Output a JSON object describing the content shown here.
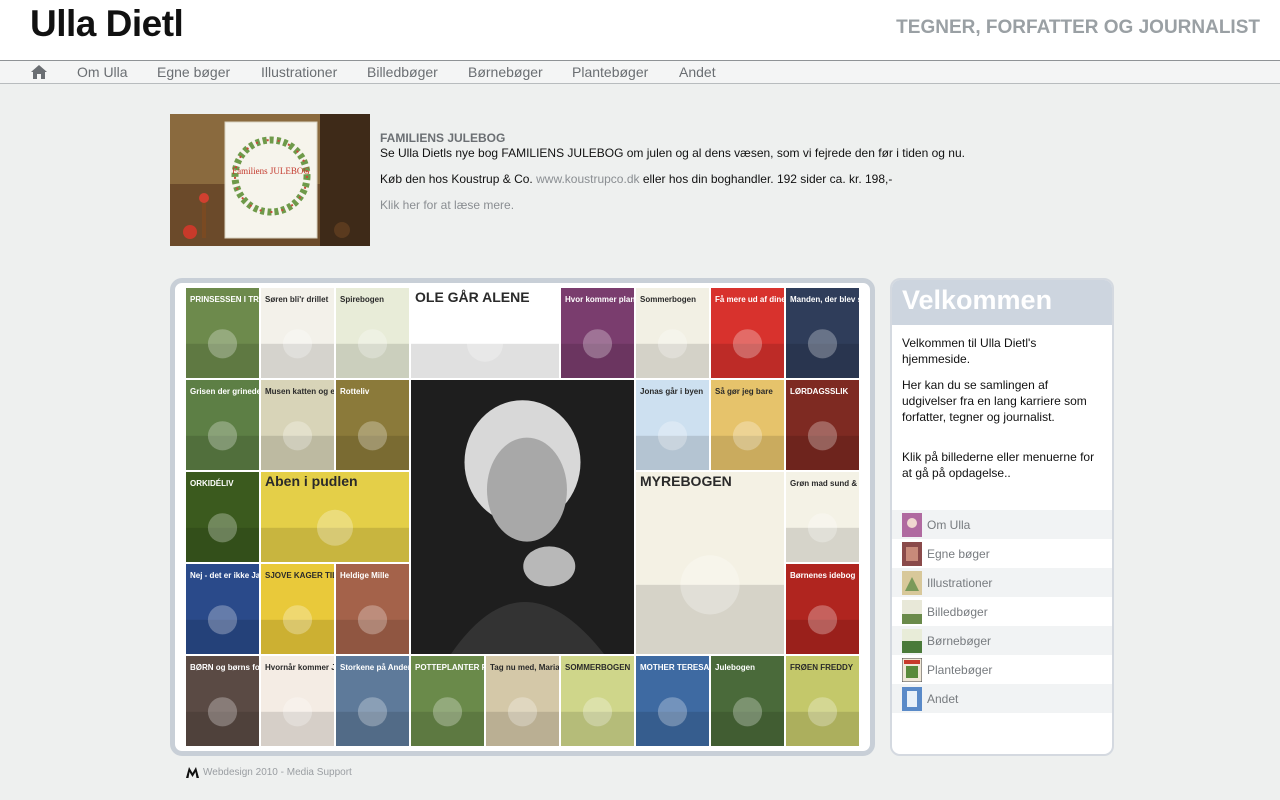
{
  "header": {
    "title": "Ulla Dietl",
    "tagline": "TEGNER, FORFATTER OG JOURNALIST"
  },
  "nav": {
    "home_icon": "home-icon",
    "items": [
      "Om Ulla",
      "Egne bøger",
      "Illustrationer",
      "Billedbøger",
      "Børnebøger",
      "Plantebøger",
      "Andet"
    ]
  },
  "feature": {
    "cover_title": "Familiens JULEBOG",
    "title": "FAMILIENS JULEBOG",
    "line1": "Se Ulla Dietls nye bog FAMILIENS JULEBOG om julen og al dens væsen, som vi fejrede den før i tiden og nu.",
    "line2_prefix": "Køb den hos Koustrup & Co.",
    "line2_link": "www.koustrupco.dk",
    "line2_suffix": "eller hos din boghandler. 192 sider ca. kr. 198,-",
    "more": "Klik her for at læse mere."
  },
  "gallery": {
    "covers": [
      {
        "title": "PRINSESSEN I TROLDBURET",
        "color": "#6d8a4c"
      },
      {
        "title": "Søren bli'r drillet",
        "color": "#f3f1ea"
      },
      {
        "title": "Spirebogen",
        "color": "#e8ecd8"
      },
      {
        "title": "OLE GÅR ALENE",
        "color": "#ffffff"
      },
      {
        "title": "Hvor kommer planterne fra",
        "color": "#7a3d6e"
      },
      {
        "title": "Sommerbogen",
        "color": "#f2f0e4"
      },
      {
        "title": "Få mere ud af dine voksne",
        "color": "#d8322d"
      },
      {
        "title": "Manden, der blev sig selv",
        "color": "#2f3d5a"
      },
      {
        "title": "Grisen der grinede",
        "color": "#5d7f45"
      },
      {
        "title": "Musen katten og elefanten",
        "color": "#d8d4b8"
      },
      {
        "title": "Rotteliv",
        "color": "#8b7a3a"
      },
      {
        "title": "Ulla Dietl portræt",
        "color": "#2a2a2a"
      },
      {
        "title": "Jonas går i byen",
        "color": "#cde0f0"
      },
      {
        "title": "Så gør jeg bare",
        "color": "#e6c36b"
      },
      {
        "title": "LØRDAGSSLIK",
        "color": "#7e2a22"
      },
      {
        "title": "ORKIDÉLIV",
        "color": "#3b5a1e"
      },
      {
        "title": "Aben i pudlen",
        "color": "#e4cf48"
      },
      {
        "title": "MYREBOGEN",
        "color": "#f4f1e4"
      },
      {
        "title": "Grøn mad sund & glad",
        "color": "#f4f2e6"
      },
      {
        "title": "Nej - det er ikke Jan!",
        "color": "#2a4a8a"
      },
      {
        "title": "SJOVE KAGER TIL FEST",
        "color": "#e9c93a"
      },
      {
        "title": "Heldige Mille",
        "color": "#a4624a"
      },
      {
        "title": "Børnenes idebog",
        "color": "#b0251f"
      },
      {
        "title": "BØRN og børns forhold",
        "color": "#5a4a44"
      },
      {
        "title": "Hvornår kommer Jeppe?",
        "color": "#f4ece4"
      },
      {
        "title": "Storkene på Andersens tag",
        "color": "#5e7a9a"
      },
      {
        "title": "POTTEPLANTER FRA LØG & KNOLDE",
        "color": "#6a8a4a"
      },
      {
        "title": "Tag nu med, Maria!",
        "color": "#d4c8a8"
      },
      {
        "title": "SOMMERBOGEN",
        "color": "#cfd68a"
      },
      {
        "title": "MOTHER TERESA",
        "color": "#3e6aa2"
      },
      {
        "title": "Julebogen",
        "color": "#4a6a3a"
      },
      {
        "title": "FRØEN FREDDY",
        "color": "#c4c86a"
      }
    ]
  },
  "welcome": {
    "heading": "Velkommen",
    "p1": "Velkommen til Ulla Dietl's hjemmeside.",
    "p2": "Her kan du se samlingen af udgivelser fra en lang karriere som forfatter, tegner og journalist.",
    "p3": "Klik på billederne eller menuerne for at gå på opdagelse..",
    "menu": [
      "Om Ulla",
      "Egne bøger",
      "Illustrationer",
      "Billedbøger",
      "Børnebøger",
      "Plantebøger",
      "Andet"
    ]
  },
  "footer": {
    "text": "Webdesign 2010 - Media Support"
  }
}
